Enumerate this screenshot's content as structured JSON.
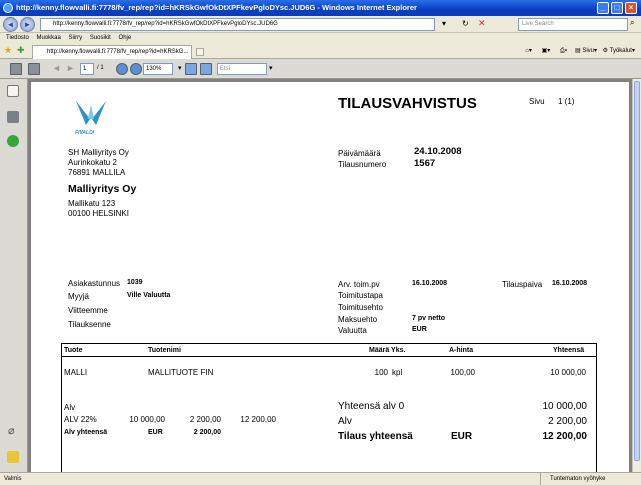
{
  "browser": {
    "title": "http://kenny.flowvalli.fi:7778/fv_rep/rep?id=hKRSkGwfOkDtXPFkevPgloDYsc.JUD6G - Windows Internet Explorer",
    "url": "http://kenny.flowvalli.fi:7778/fv_rep/rep?id=hKRSkGwfOkDtXPFkevPgloDYsc.JUD6G",
    "search_placeholder": "Live Search",
    "menu": [
      "Tiedosto",
      "Muokkaa",
      "Siirry",
      "Suosikit",
      "Ohje"
    ],
    "tab_label": "http://kenny.flowvalli.fi:7778/fv_rep/rep?id=hKRSkG...",
    "sivu_label": "Sivu",
    "tools_label": "Työkalut",
    "status_left": "Valmis",
    "status_zone": "Tuntematon vyöhyke"
  },
  "viewer": {
    "page_number": "1",
    "page_count": "/ 1",
    "zoom": "130%",
    "find_placeholder": "Etsi"
  },
  "doc": {
    "logo_text": "FIVALDI",
    "title": "TILAUSVAHVISTUS",
    "sivu_label": "Sivu",
    "sivu_value": "1 (1)",
    "sender": [
      "SH Malliyritys Oy",
      "Aurinkokatu 2",
      "76891 MALLILA"
    ],
    "recipient_name": "Malliyritys Oy",
    "recipient_lines": [
      "Mallikatu 123",
      "00100  HELSINKI"
    ],
    "paivamaara_label": "Päivämäärä",
    "paivamaara_value": "24.10.2008",
    "tilausnumero_label": "Tilausnumero",
    "tilausnumero_value": "1567",
    "asiakastunnus_label": "Asiakastunnus",
    "asiakastunnus_value": "1039",
    "myyja_label": "Myyjä",
    "myyja_value": "Ville Valuutta",
    "viitteemme_label": "Viitteemme",
    "tilauksenne_label": "Tilauksenne",
    "arv_toim_label": "Arv. toim.pv",
    "arv_toim_value": "16.10.2008",
    "toimitustapa_label": "Toimitustapa",
    "toimitusehto_label": "Toimitusehto",
    "maksuehto_label": "Maksuehto",
    "maksuehto_value": "7 pv netto",
    "valuutta_label": "Valuutta",
    "valuutta_value": "EUR",
    "tilauspaiva_label": "Tilauspaiva",
    "tilauspaiva_value": "16.10.2008",
    "table_headers": {
      "tuote": "Tuote",
      "tuotenimi": "Tuotenimi",
      "maara_yks": "Määrä Yks.",
      "a_hinta": "A-hinta",
      "yhteensa": "Yhteensä"
    },
    "rows": [
      {
        "tuote": "MALLI",
        "tuotenimi": "MALLITUOTE FIN",
        "maara": "100",
        "yks": "kpl",
        "a_hinta": "100,00",
        "yhteensa": "10 000,00"
      }
    ],
    "alv_label": "Alv",
    "alv_row": [
      "ALV 22%",
      "10 000,00",
      "2 200,00",
      "12 200,00"
    ],
    "alv_total_label": "Alv yhteensä",
    "alv_total_currency": "EUR",
    "alv_total_value": "2 200,00",
    "sum_alv0_label": "Yhteensä alv 0",
    "sum_alv0_value": "10 000,00",
    "sum_alv_label": "Alv",
    "sum_alv_value": "2 200,00",
    "sum_total_label": "Tilaus yhteensä",
    "sum_total_currency": "EUR",
    "sum_total_value": "12 200,00"
  },
  "colors": {
    "logo": "#2a93c7",
    "titlebar": "#0a3fc4"
  }
}
